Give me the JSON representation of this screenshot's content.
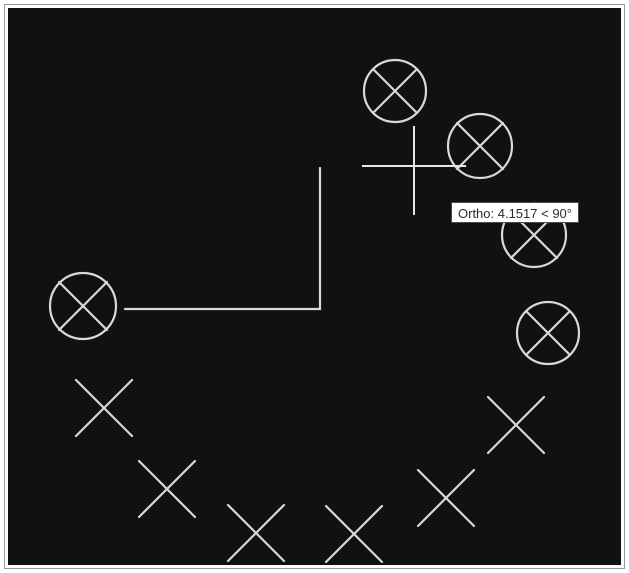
{
  "canvas": {
    "background_color": "#111111",
    "line_color": "#d9d9d9"
  },
  "tooltip": {
    "label": "Ortho: 4.1517 < 90°"
  }
}
